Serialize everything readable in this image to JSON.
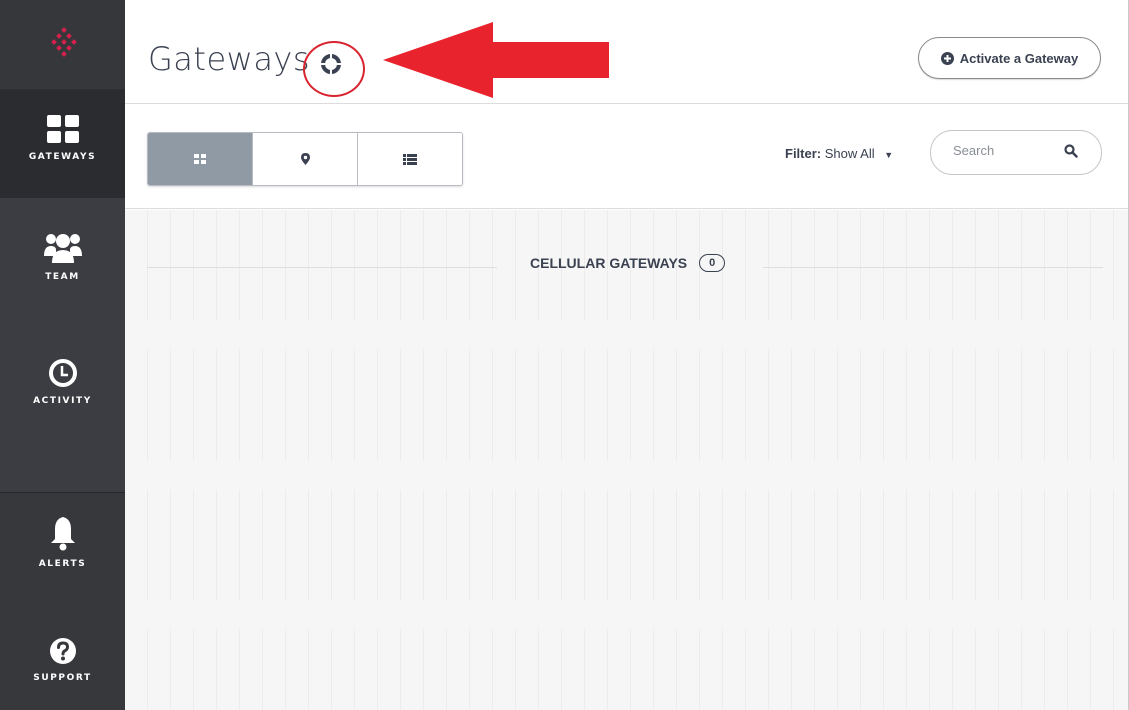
{
  "sidebar": {
    "items": [
      {
        "id": "gateways",
        "label": "GATEWAYS",
        "icon": "grid-icon"
      },
      {
        "id": "team",
        "label": "TEAM",
        "icon": "team-icon"
      },
      {
        "id": "activity",
        "label": "ACTIVITY",
        "icon": "clock-icon"
      },
      {
        "id": "alerts",
        "label": "ALERTS",
        "icon": "bell-icon"
      },
      {
        "id": "support",
        "label": "SUPPORT",
        "icon": "question-icon"
      }
    ],
    "active": "gateways"
  },
  "header": {
    "title": "Gateways",
    "help_icon": "lifebuoy-icon",
    "activate_label": "Activate a Gateway"
  },
  "toolbar": {
    "views": [
      {
        "id": "grid",
        "icon": "grid-view-icon",
        "active": true
      },
      {
        "id": "map",
        "icon": "map-pin-icon",
        "active": false
      },
      {
        "id": "list",
        "icon": "list-view-icon",
        "active": false
      }
    ],
    "filter_label": "Filter:",
    "filter_value": "Show All",
    "search_placeholder": "Search"
  },
  "main": {
    "section_title": "CELLULAR GATEWAYS",
    "count": "0"
  },
  "colors": {
    "sidebar_bg": "#3b3d42",
    "sidebar_active": "#2a2c30",
    "logo_red": "#d6204c",
    "text_dark": "#3a4150",
    "toggle_active": "#8f9aa4",
    "annotation_red": "#e8232d"
  }
}
